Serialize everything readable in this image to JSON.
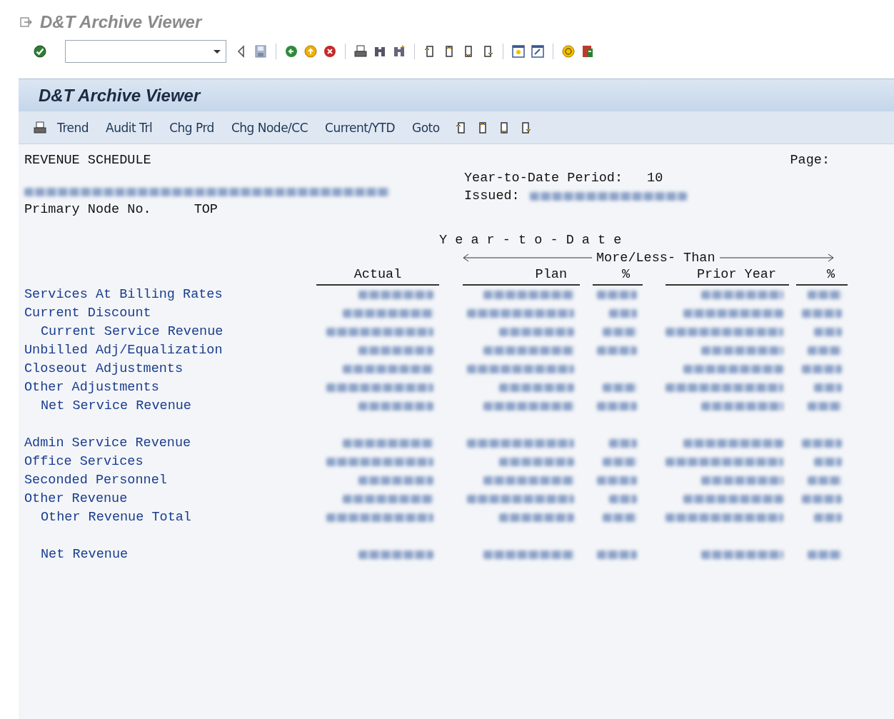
{
  "window": {
    "title": "D&T Archive Viewer"
  },
  "screen_title": "D&T Archive Viewer",
  "app_toolbar": {
    "buttons": [
      "Trend",
      "Audit Trl",
      "Chg Prd",
      "Chg Node/CC",
      "Current/YTD",
      "Goto"
    ]
  },
  "report": {
    "title": "REVENUE SCHEDULE",
    "page_label": "Page:",
    "period_label": "Year-to-Date Period:",
    "period": "10",
    "issued_label": "Issued:",
    "node_label": "Primary Node No.",
    "node": "TOP",
    "group_heading": "Y e a r - t o - D a t e",
    "compare_heading": "More/Less- Than",
    "columns": [
      "Actual",
      "Plan",
      "%",
      "Prior Year",
      "%"
    ],
    "rows": [
      {
        "label": "Services At Billing Rates",
        "kind": "line",
        "cells": [
          true,
          true,
          true,
          true,
          true
        ]
      },
      {
        "label": "Current Discount",
        "kind": "line",
        "cells": [
          true,
          true,
          true,
          true,
          true
        ]
      },
      {
        "label": "Current Service Revenue",
        "kind": "subtotal",
        "cells": [
          true,
          true,
          true,
          true,
          true
        ]
      },
      {
        "label": "Unbilled Adj/Equalization",
        "kind": "line",
        "cells": [
          true,
          true,
          true,
          true,
          true
        ]
      },
      {
        "label": "Closeout Adjustments",
        "kind": "line",
        "cells": [
          true,
          true,
          false,
          true,
          true
        ]
      },
      {
        "label": "Other Adjustments",
        "kind": "line",
        "cells": [
          true,
          true,
          true,
          true,
          true
        ]
      },
      {
        "label": "Net Service Revenue",
        "kind": "subtotal",
        "cells": [
          true,
          true,
          true,
          true,
          true
        ]
      },
      {
        "label": "Admin Service Revenue",
        "kind": "line",
        "gap_before": true,
        "cells": [
          true,
          true,
          true,
          true,
          true
        ]
      },
      {
        "label": "Office Services",
        "kind": "line",
        "cells": [
          true,
          true,
          true,
          true,
          true
        ]
      },
      {
        "label": "Seconded Personnel",
        "kind": "line",
        "cells": [
          true,
          true,
          true,
          true,
          true
        ]
      },
      {
        "label": "Other Revenue",
        "kind": "line",
        "cells": [
          true,
          true,
          true,
          true,
          true
        ]
      },
      {
        "label": "Other Revenue Total",
        "kind": "subtotal",
        "cells": [
          true,
          true,
          true,
          true,
          true
        ]
      },
      {
        "label": "Net Revenue",
        "kind": "subtotal",
        "gap_before": true,
        "cells": [
          true,
          true,
          true,
          true,
          true
        ]
      }
    ]
  }
}
